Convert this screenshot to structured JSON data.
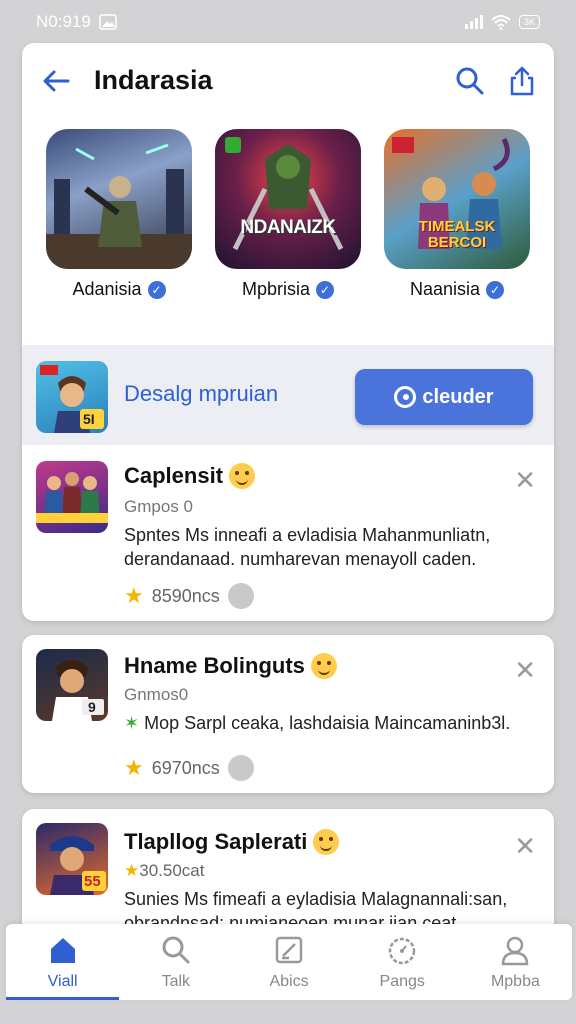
{
  "status_bar": {
    "time": "N0:919",
    "battery": "3K"
  },
  "header": {
    "title": "Indarasia"
  },
  "featured": [
    {
      "name": "Adanisia",
      "art_text": ""
    },
    {
      "name": "Mpbrisia",
      "art_text": "NDANAIZK"
    },
    {
      "name": "Naanisia",
      "art_text": "TIMEALSK BERCOI"
    }
  ],
  "promo": {
    "text": "Desalg mpruian",
    "button_label": "cleuder",
    "badge": "5I"
  },
  "items": [
    {
      "name": "Caplensit",
      "sub": "Gmpos 0",
      "desc": "Spntes Ms inneafi a evladisia Mahanmunliatn, derandanaad. numharevan menayoll caden.",
      "rating": "8590ncs"
    },
    {
      "name": "Hname Bolinguts",
      "sub": "Gnmos0",
      "desc": "Mop Sarpl ceaka, lashdaisia Maincamaninb3l.",
      "rating": "6970ncs",
      "badge": "9"
    },
    {
      "name": "Tlapllog Saplerati",
      "sub": "30.50cat",
      "desc": "Sunies Ms fimeafi a eyladisia Malagnannali:san, obrandnsad: numianeoen munar ijan ceat .",
      "badge": "55"
    }
  ],
  "nav": [
    {
      "label": "Viall",
      "icon": "home-icon",
      "active": true
    },
    {
      "label": "Talk",
      "icon": "search-icon",
      "active": false
    },
    {
      "label": "Abics",
      "icon": "edit-icon",
      "active": false
    },
    {
      "label": "Pangs",
      "icon": "timer-icon",
      "active": false
    },
    {
      "label": "Mpbba",
      "icon": "profile-icon",
      "active": false
    }
  ],
  "colors": {
    "accent": "#4a74dc",
    "link": "#2f5fd0",
    "verified": "#3d6fd8",
    "star": "#f5b400"
  }
}
